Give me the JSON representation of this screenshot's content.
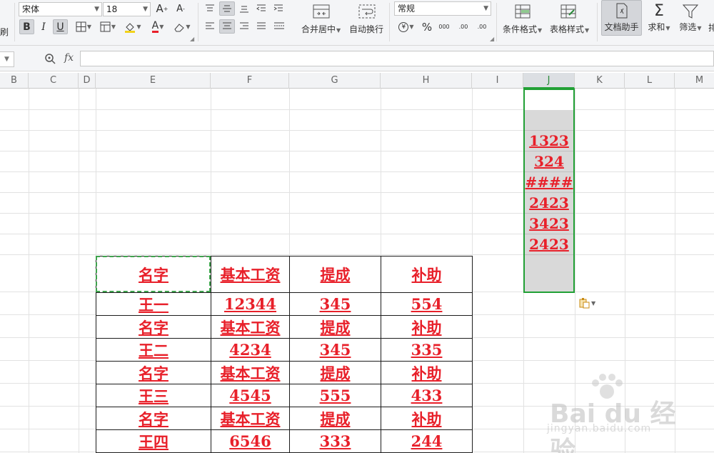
{
  "ribbon": {
    "copy_label_fragment": "刷",
    "font_name": "宋体",
    "font_size": "18",
    "grow_font": "A",
    "shrink_font": "A",
    "bold": "B",
    "italic": "I",
    "underline": "U",
    "font_color_letter": "A",
    "merge_center": "合并居中",
    "wrap_text": "自动换行",
    "number_format": "常规",
    "percent": "%",
    "thousands": "000",
    "inc_decimal": ".00",
    "dec_decimal": ".00",
    "conditional_format": "条件格式",
    "table_style": "表格样式",
    "doc_assistant": "文档助手",
    "sum": "求和",
    "filter": "筛选",
    "cut_off": "排"
  },
  "formula_bar": {
    "fx_label": "fx",
    "value": ""
  },
  "columns": [
    "B",
    "C",
    "D",
    "E",
    "F",
    "G",
    "H",
    "I",
    "J",
    "K",
    "L",
    "M"
  ],
  "selected_column": "J",
  "table": {
    "header": [
      "名字",
      "基本工资",
      "提成",
      "补助"
    ],
    "rows": [
      [
        "王一",
        "12344",
        "345",
        "554"
      ],
      [
        "名字",
        "基本工资",
        "提成",
        "补助"
      ],
      [
        "王二",
        "4234",
        "345",
        "335"
      ],
      [
        "名字",
        "基本工资",
        "提成",
        "补助"
      ],
      [
        "王三",
        "4545",
        "555",
        "433"
      ],
      [
        "名字",
        "基本工资",
        "提成",
        "补助"
      ],
      [
        "王四",
        "6546",
        "333",
        "244"
      ]
    ]
  },
  "column_j": [
    "",
    "",
    "1323",
    "324",
    "####",
    "2423",
    "3423",
    "2423",
    ""
  ],
  "watermark": {
    "brand": "Bai du 经验",
    "url": "jingyan.baidu.com"
  }
}
